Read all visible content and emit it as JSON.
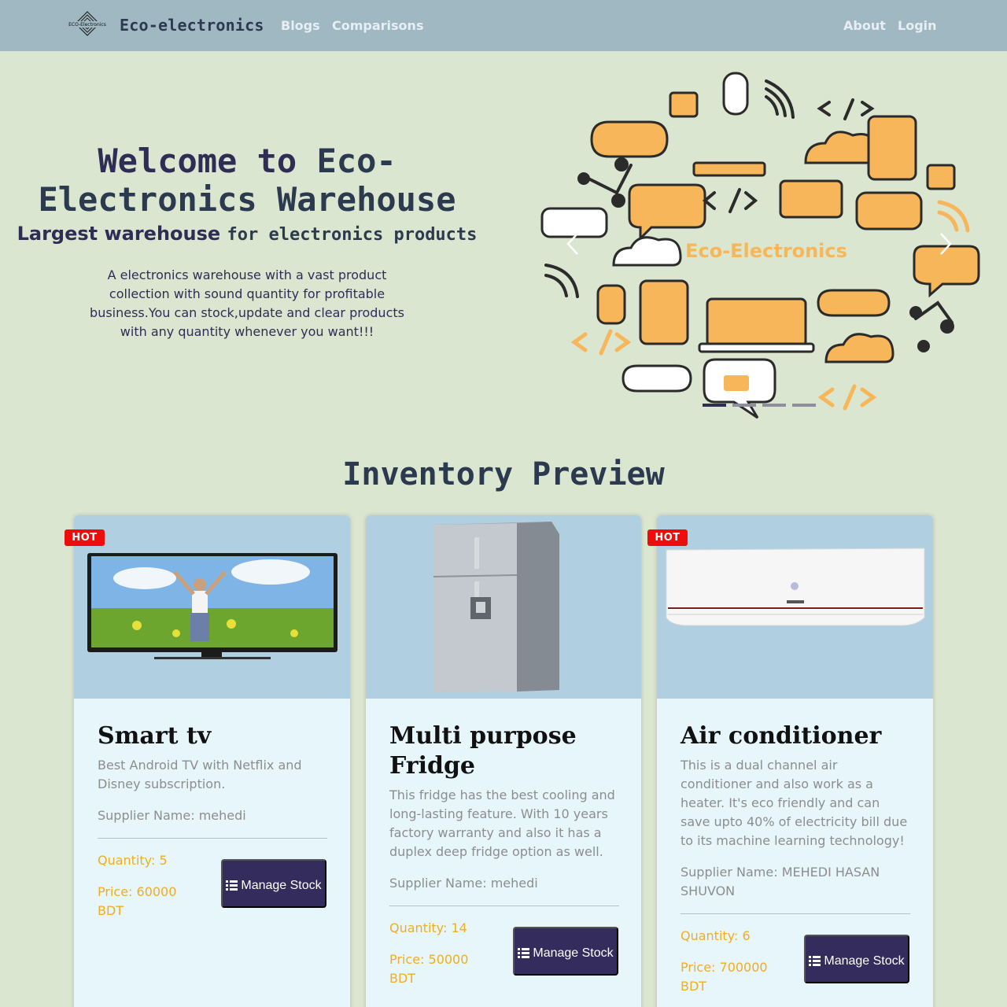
{
  "nav": {
    "brand_logo_text": "ECO-Electronics",
    "brand": "Eco-electronics",
    "links": [
      "Blogs",
      "Comparisons"
    ],
    "right_links": [
      "About",
      "Login"
    ]
  },
  "hero": {
    "title_prefix": "Welcome to ",
    "title_bold": "Eco-Electronics Warehouse",
    "subtitle_prefix": "Largest warehouse ",
    "subtitle_bold": "for electronics products",
    "description": "A electronics warehouse with a vast product collection with sound quantity for profitable business.You can stock,update and clear products with any quantity whenever you want!!!"
  },
  "carousel": {
    "banner_text": "Eco-Electronics",
    "active_index": 0,
    "slide_count": 4,
    "accent": "#f7b65a"
  },
  "section": {
    "title": "Inventory Preview"
  },
  "products": [
    {
      "badge": "HOT",
      "name": "Smart tv",
      "description": "Best Android TV with Netflix and Disney subscription.",
      "supplier": "Supplier Name: mehedi",
      "quantity": "Quantity: 5",
      "price": "Price: 60000 BDT",
      "button": "Manage Stock"
    },
    {
      "badge": "",
      "name": "Multi purpose Fridge",
      "description": "This fridge has the best cooling and long-lasting feature. With 10 years factory warranty and also it has a duplex deep fridge option as well.",
      "supplier": "Supplier Name: mehedi",
      "quantity": "Quantity: 14",
      "price": "Price: 50000 BDT",
      "button": "Manage Stock"
    },
    {
      "badge": "HOT",
      "name": "Air conditioner",
      "description": "This is a dual channel air conditioner and also work as a heater. It's eco friendly and can save upto 40% of electricity bill due to its machine learning technology!",
      "supplier": "Supplier Name: MEHEDI HASAN SHUVON",
      "quantity": "Quantity: 6",
      "price": "Price: 700000 BDT",
      "button": "Manage Stock"
    }
  ],
  "colors": {
    "navbar": "#9fb8c1",
    "page_bg": "#dbe6d0",
    "button": "#342c5d",
    "badge": "#ee0d0d",
    "price": "#f0ad20"
  }
}
